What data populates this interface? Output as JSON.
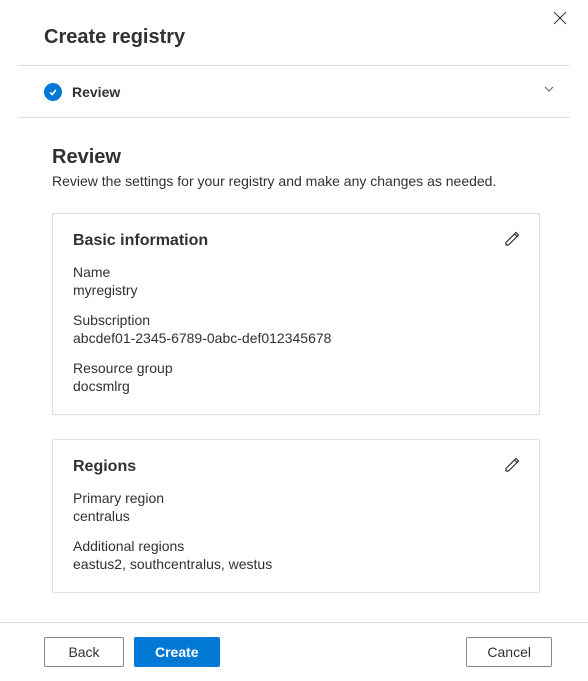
{
  "panel": {
    "title": "Create registry",
    "step_label": "Review"
  },
  "review": {
    "title": "Review",
    "desc": "Review the settings for your registry and make any changes as needed."
  },
  "basic": {
    "title": "Basic information",
    "name_label": "Name",
    "name_value": "myregistry",
    "subscription_label": "Subscription",
    "subscription_value": "abcdef01-2345-6789-0abc-def012345678",
    "rg_label": "Resource group",
    "rg_value": "docsmlrg"
  },
  "regions": {
    "title": "Regions",
    "primary_label": "Primary region",
    "primary_value": "centralus",
    "additional_label": "Additional regions",
    "additional_value": "eastus2, southcentralus, westus"
  },
  "footer": {
    "back": "Back",
    "create": "Create",
    "cancel": "Cancel"
  }
}
